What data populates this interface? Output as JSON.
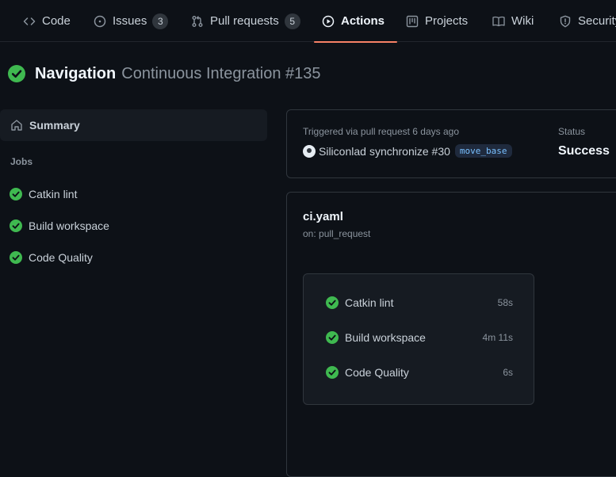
{
  "tabs": [
    {
      "label": "Code"
    },
    {
      "label": "Issues",
      "count": "3"
    },
    {
      "label": "Pull requests",
      "count": "5"
    },
    {
      "label": "Actions"
    },
    {
      "label": "Projects"
    },
    {
      "label": "Wiki"
    },
    {
      "label": "Security"
    }
  ],
  "run": {
    "title_bold": "Navigation",
    "title_rest": "Continuous Integration #135",
    "status_icon": "check-circle-icon"
  },
  "sidebar": {
    "summary_label": "Summary",
    "jobs_heading": "Jobs",
    "jobs": [
      {
        "label": "Catkin lint"
      },
      {
        "label": "Build workspace"
      },
      {
        "label": "Code Quality"
      }
    ]
  },
  "trigger": {
    "text": "Triggered via pull request 6 days ago",
    "actor": "Siliconlad",
    "action": "synchronize #30",
    "branch": "move_base",
    "status_label": "Status",
    "status_value": "Success"
  },
  "workflow": {
    "file": "ci.yaml",
    "on": "on: pull_request",
    "jobs": [
      {
        "name": "Catkin lint",
        "duration": "58s"
      },
      {
        "name": "Build workspace",
        "duration": "4m 11s"
      },
      {
        "name": "Code Quality",
        "duration": "6s"
      }
    ]
  },
  "colors": {
    "success": "#3fb950",
    "accent_underline": "#f78166",
    "background": "#0d1117"
  }
}
